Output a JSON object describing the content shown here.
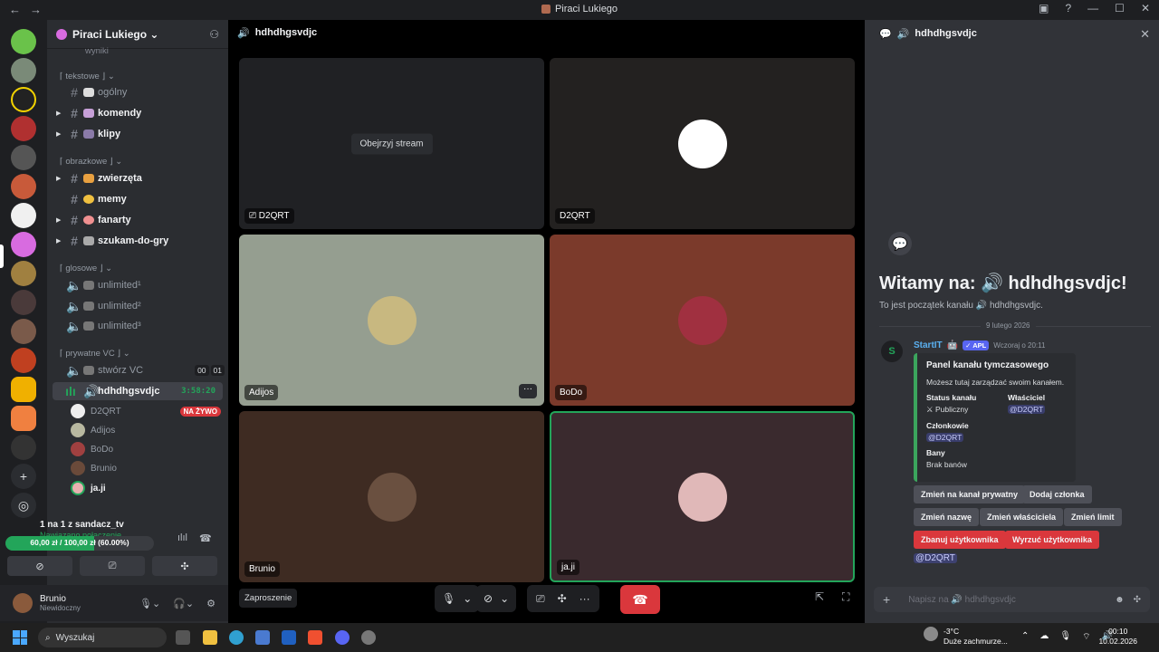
{
  "titlebar": {
    "title": "Piraci Lukiego",
    "back": "←",
    "forward": "→",
    "minimize": "—",
    "maximize": "☐",
    "close": "✕"
  },
  "guild": {
    "name": "Piraci Lukiego ⌄"
  },
  "channels": {
    "partial_top": "wyniki",
    "cat_text": "⌈ tekstowe ⌋ ⌄",
    "ogolny": "ogólny",
    "komendy": "komendy",
    "klipy": "klipy",
    "cat_img": "⌈ obrazkowe ⌋ ⌄",
    "zwierzeta": "zwierzęta",
    "memy": "memy",
    "fanarty": "fanarty",
    "szukam": "szukam-do-gry",
    "cat_voice": "⌈ glosowe ⌋ ⌄",
    "unl1": "unlimited¹",
    "unl2": "unlimited²",
    "unl3": "unlimited³",
    "cat_priv": "⌈ prywatne VC ⌋ ⌄",
    "stworz": "stwórz VC",
    "stworz_a": "00",
    "stworz_b": "01",
    "active": "hdhdhgsvdjc",
    "timer": "3:58:20",
    "users": [
      "D2QRT",
      "Adijos",
      "BoDo",
      "Brunio",
      "ja.ji"
    ],
    "live": "NA ŻYWO"
  },
  "voice_panel": {
    "title": "1 na 1 z sandacz_tv",
    "status": "Nawiązano połączenie",
    "progress_label": "60,00 zł / 100,00 zł (60.00%)",
    "progress": 0.6
  },
  "me": {
    "name": "Brunio",
    "status": "Niewidoczny"
  },
  "main": {
    "header": "hdhdhgsvdjc",
    "watch": "Obejrzyj stream",
    "tiles": [
      "D2QRT",
      "D2QRT",
      "Adijos",
      "BoDo",
      "Brunio",
      "ja.ji"
    ],
    "invite": "Zaproszenie"
  },
  "chat": {
    "header": "hdhdhgsvdjc",
    "welcome": "Witamy na: 🔊 hdhdhgsvdjc!",
    "welcome_sub": "To jest początek kanału 🔊 hdhdhgsvdjc.",
    "date": "9 lutego 2026",
    "author": "StartIT",
    "app": "✓ APL",
    "time": "Wczoraj o 20:11",
    "embed_title": "Panel kanału tymczasowego",
    "embed_desc": "Możesz tutaj zarządzać swoim kanałem.",
    "f_status_k": "Status kanału",
    "f_status_v": "Publiczny",
    "f_owner_k": "Właściciel",
    "f_owner_v": "@D2QRT",
    "f_members_k": "Członkowie",
    "f_members_v": "@D2QRT",
    "f_bans_k": "Bany",
    "f_bans_v": "Brak banów",
    "btn1": "Zmień na kanał prywatny",
    "btn2": "Dodaj członka",
    "btn3": "Zmień nazwę",
    "btn4": "Zmień właściciela",
    "btn5": "Zmień limit",
    "btn6": "Zbanuj użytkownika",
    "btn7": "Wyrzuć użytkownika",
    "mention": "@D2QRT",
    "placeholder": "Napisz na 🔊 hdhdhgsvdjc"
  },
  "taskbar": {
    "search": "Wyszukaj",
    "temp": "-3°C",
    "weather": "Duże zachmurze...",
    "time": "00:10",
    "date": "10.02.2026"
  }
}
